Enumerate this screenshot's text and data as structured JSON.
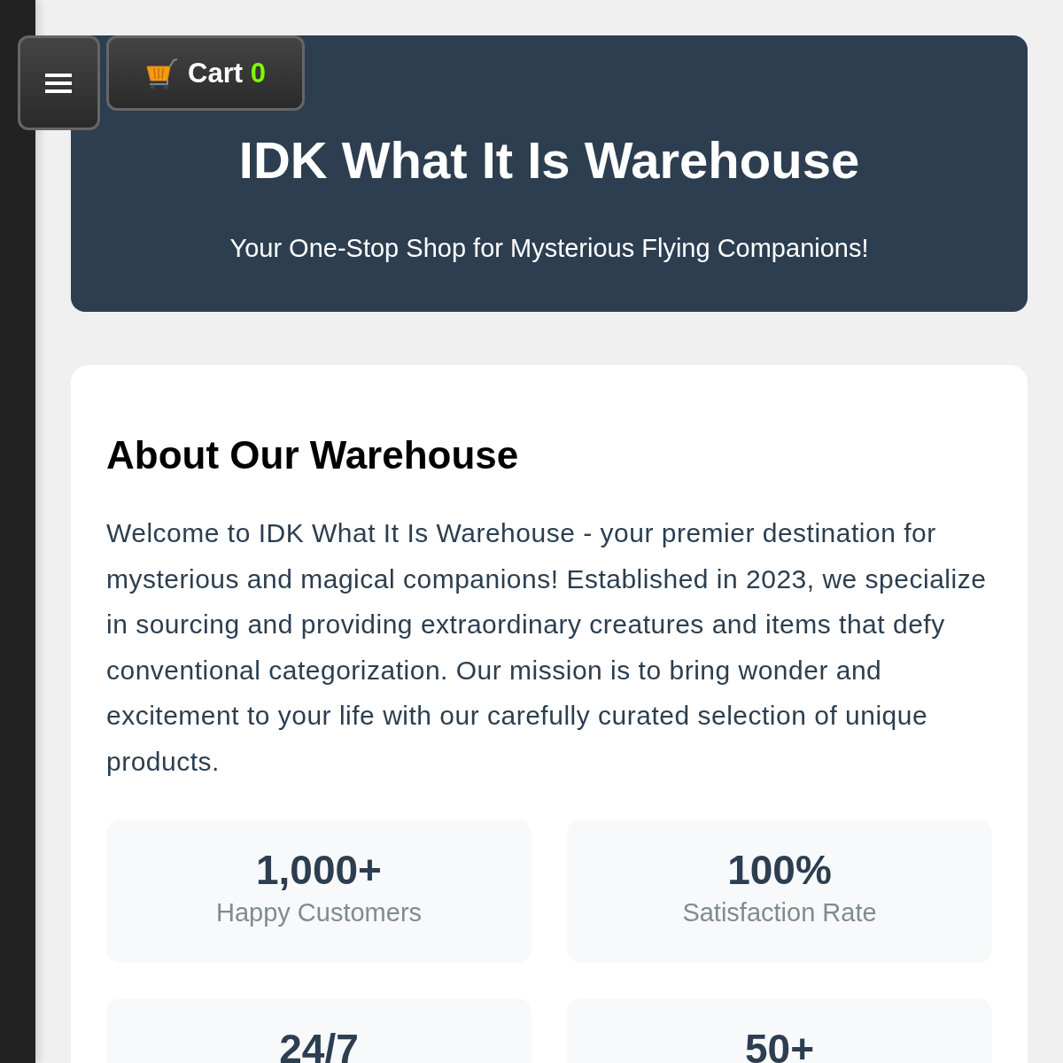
{
  "cart": {
    "label": "Cart",
    "count": "0"
  },
  "header": {
    "title": "IDK What It Is Warehouse",
    "subtitle": "Your One-Stop Shop for Mysterious Flying Companions!"
  },
  "about": {
    "heading": "About Our Warehouse",
    "text": "Welcome to IDK What It Is Warehouse - your premier destination for mysterious and magical companions! Established in 2023, we specialize in sourcing and providing extraordinary creatures and items that defy conventional categorization. Our mission is to bring wonder and excitement to your life with our carefully curated selection of unique products.",
    "stats": [
      {
        "value": "1,000+",
        "label": "Happy Customers"
      },
      {
        "value": "100%",
        "label": "Satisfaction Rate"
      },
      {
        "value": "24/7"
      },
      {
        "value": "50+"
      }
    ]
  }
}
